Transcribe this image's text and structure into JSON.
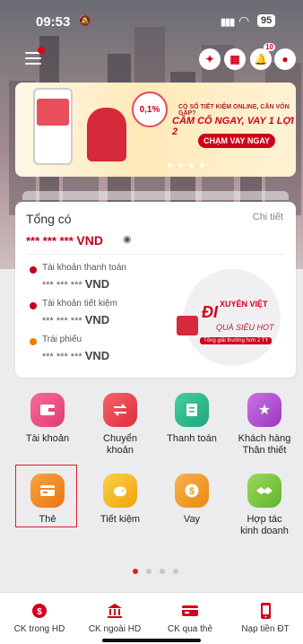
{
  "status_bar": {
    "time": "09:53",
    "mute_icon": "bell-slash-icon",
    "battery": "95"
  },
  "header": {
    "menu_icon": "menu-icon",
    "notification_count": "10"
  },
  "banner": {
    "rate": "0,1%",
    "line1": "CÓ SỔ TIẾT KIỆM ONLINE, CẦN VỐN GẤP?",
    "line2": "CẦM CỐ NGAY, VAY 1 LỢI 2",
    "cta": "CHẠM VAY NGAY"
  },
  "balance": {
    "title": "Tổng có",
    "detail_link": "Chi tiết",
    "total_masked": "*** *** ***",
    "currency": "VND",
    "accounts": [
      {
        "label": "Tài khoản thanh toán",
        "masked": "*** *** ***",
        "currency": "VND",
        "color": "#c4001a"
      },
      {
        "label": "Tài khoản tiết kiệm",
        "masked": "*** *** ***",
        "currency": "VND",
        "color": "#c4001a"
      },
      {
        "label": "Trái phiếu",
        "masked": "*** *** ***",
        "currency": "VND",
        "color": "#f07d00"
      }
    ],
    "promo": {
      "word1": "ĐI",
      "word2": "XUYÊN VIỆT",
      "word3": "QUÀ SIÊU HOT",
      "tag": "Tổng giải thưởng hơn 2 TỶ"
    }
  },
  "services": [
    {
      "label": "Tài khoản",
      "icon": "wallet-icon",
      "color": "#e8457b"
    },
    {
      "label": "Chuyển khoản",
      "icon": "transfer-icon",
      "color": "#e8434d"
    },
    {
      "label": "Thanh toán",
      "icon": "bill-icon",
      "color": "#2fb58d"
    },
    {
      "label": "Khách hàng Thân thiết",
      "icon": "star-icon",
      "color": "#b54ed1"
    },
    {
      "label": "Thẻ",
      "icon": "card-icon",
      "color": "#f08a1e"
    },
    {
      "label": "Tiết kiệm",
      "icon": "piggy-bank-icon",
      "color": "#f6b51c"
    },
    {
      "label": "Vay",
      "icon": "dollar-coin-icon",
      "color": "#f0a01e"
    },
    {
      "label": "Hợp tác kinh doanh",
      "icon": "handshake-icon",
      "color": "#7fc842"
    }
  ],
  "bottom_nav": [
    {
      "label": "CK trong HD",
      "icon": "transfer-internal-icon"
    },
    {
      "label": "CK ngoài HD",
      "icon": "bank-icon"
    },
    {
      "label": "CK qua thẻ",
      "icon": "card-transfer-icon"
    },
    {
      "label": "Nạp tiền ĐT",
      "icon": "phone-topup-icon"
    }
  ],
  "colors": {
    "brand": "#e11d2a",
    "text": "#222222"
  }
}
